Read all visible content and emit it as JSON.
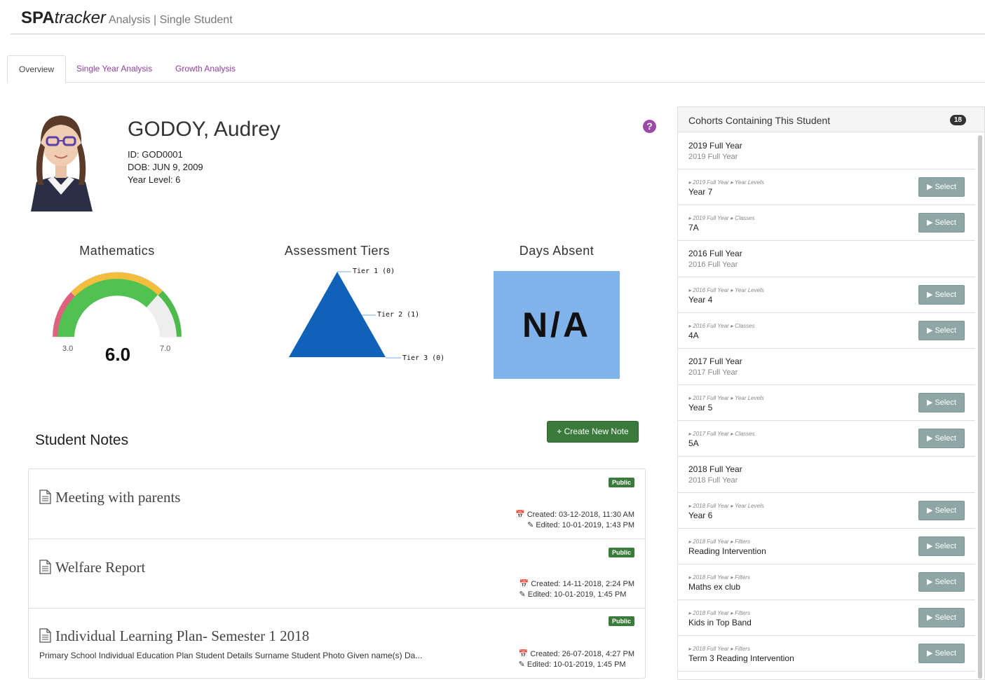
{
  "header": {
    "brand_bold": "SPA",
    "brand_italic": "tracker",
    "subtitle": "Analysis | Single Student"
  },
  "tabs": [
    {
      "label": "Overview"
    },
    {
      "label": "Single Year Analysis"
    },
    {
      "label": "Growth Analysis"
    }
  ],
  "student": {
    "name": "GODOY, Audrey",
    "id_line": "ID: GOD0001",
    "dob_line": "DOB: JUN 9, 2009",
    "year_line": "Year Level: 6",
    "help_icon_glyph": "?"
  },
  "mathematics": {
    "title": "Mathematics",
    "value": "6.0",
    "min": "3.0",
    "max": "7.0"
  },
  "assessment_tiers": {
    "title": "Assessment Tiers",
    "tier1": "Tier 1 (0)",
    "tier2": "Tier 2 (1)",
    "tier3": "Tier 3 (0)",
    "color": "#0f62b8"
  },
  "days_absent": {
    "title": "Days Absent",
    "value": "N/A"
  },
  "notes": {
    "title": "Student Notes",
    "create_label": "+ Create New Note",
    "items": [
      {
        "title": "Meeting with parents",
        "badge": "Public",
        "created": "Created: 03-12-2018, 11:30 AM",
        "edited": "Edited: 10-01-2019, 1:43 PM",
        "excerpt": ""
      },
      {
        "title": "Welfare Report",
        "badge": "Public",
        "created": "Created: 14-11-2018, 2:24 PM",
        "edited": "Edited: 10-01-2019, 1:45 PM",
        "excerpt": ""
      },
      {
        "title": "Individual Learning Plan- Semester 1 2018",
        "badge": "Public",
        "created": "Created: 26-07-2018, 4:27 PM",
        "edited": "Edited: 10-01-2019, 1:45 PM",
        "excerpt": "Primary School Individual Education Plan Student Details Surname Student Photo Given name(s) Da..."
      }
    ]
  },
  "cohorts": {
    "title": "Cohorts Containing This Student",
    "count": "18",
    "select_label": "▶ Select",
    "items": [
      {
        "kind": "group",
        "name": "2019 Full Year",
        "sub": "2019 Full Year"
      },
      {
        "kind": "item",
        "crumb1": "2019 Full Year",
        "crumb2": "Year Levels",
        "name": "Year 7"
      },
      {
        "kind": "item",
        "crumb1": "2019 Full Year",
        "crumb2": "Classes",
        "name": "7A"
      },
      {
        "kind": "group",
        "name": "2016 Full Year",
        "sub": "2016 Full Year"
      },
      {
        "kind": "item",
        "crumb1": "2016 Full Year",
        "crumb2": "Year Levels",
        "name": "Year 4"
      },
      {
        "kind": "item",
        "crumb1": "2016 Full Year",
        "crumb2": "Classes",
        "name": "4A"
      },
      {
        "kind": "group",
        "name": "2017 Full Year",
        "sub": "2017 Full Year"
      },
      {
        "kind": "item",
        "crumb1": "2017 Full Year",
        "crumb2": "Year Levels",
        "name": "Year 5"
      },
      {
        "kind": "item",
        "crumb1": "2017 Full Year",
        "crumb2": "Classes",
        "name": "5A"
      },
      {
        "kind": "group",
        "name": "2018 Full Year",
        "sub": "2018 Full Year"
      },
      {
        "kind": "item",
        "crumb1": "2018 Full Year",
        "crumb2": "Year Levels",
        "name": "Year 6"
      },
      {
        "kind": "item",
        "crumb1": "2018 Full Year",
        "crumb2": "Filters",
        "name": "Reading Intervention"
      },
      {
        "kind": "item",
        "crumb1": "2018 Full Year",
        "crumb2": "Filters",
        "name": "Maths ex club"
      },
      {
        "kind": "item",
        "crumb1": "2018 Full Year",
        "crumb2": "Filters",
        "name": "Kids in Top Band"
      },
      {
        "kind": "item",
        "crumb1": "2018 Full Year",
        "crumb2": "Filters",
        "name": "Term 3 Reading Intervention"
      }
    ]
  },
  "colors": {
    "accent": "#8e3f9e",
    "green": "#3a7a3a",
    "select": "#8fa7a4",
    "absent_bg": "#7fb3ea"
  }
}
